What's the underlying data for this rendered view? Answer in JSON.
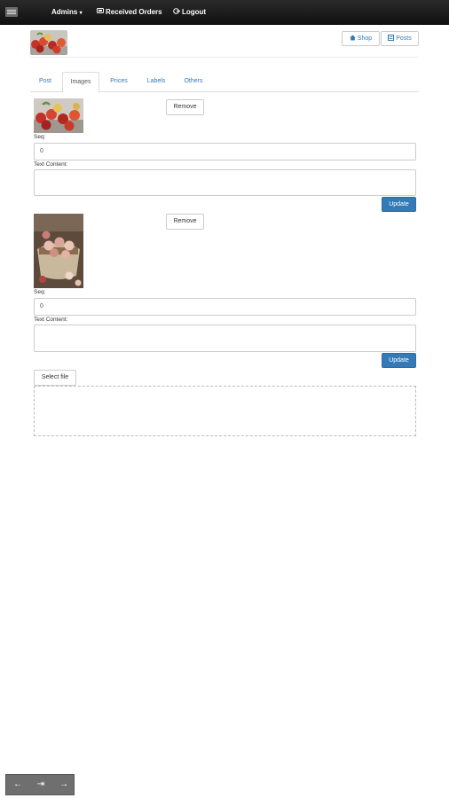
{
  "navbar": {
    "admins_label": "Admins",
    "admins_caret": "▾",
    "orders_label": "Received Orders",
    "logout_label": "Logout"
  },
  "header": {
    "shop_label": "Shop",
    "posts_label": "Posts"
  },
  "tabs": [
    {
      "label": "Post",
      "active": false
    },
    {
      "label": "Images",
      "active": true
    },
    {
      "label": "Prices",
      "active": false
    },
    {
      "label": "Labels",
      "active": false
    },
    {
      "label": "Others",
      "active": false
    }
  ],
  "images": [
    {
      "remove_label": "Remove",
      "seq_label": "Seq:",
      "seq_value": "0",
      "text_label": "Text Content:",
      "text_value": "",
      "update_label": "Update"
    },
    {
      "remove_label": "Remove",
      "seq_label": "Seq:",
      "seq_value": "0",
      "text_label": "Text Content:",
      "text_value": "",
      "update_label": "Update"
    }
  ],
  "upload": {
    "select_label": "Select file"
  },
  "bottom_bar": {
    "back_icon": "←",
    "exit_icon": "⇥",
    "forward_icon": "→"
  },
  "colors": {
    "navbar": "#1a1a1a",
    "primary": "#337ab7",
    "link": "#337ab7"
  }
}
